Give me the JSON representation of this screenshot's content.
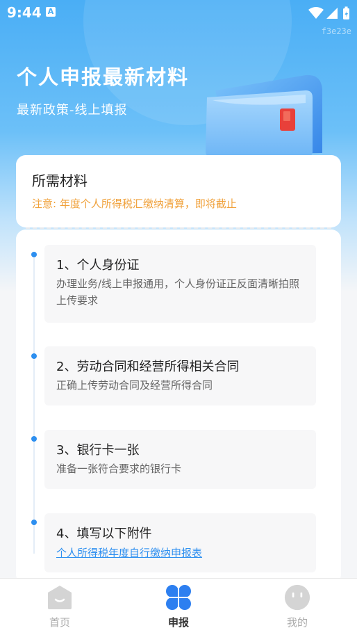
{
  "status_bar": {
    "time": "9:44",
    "notification_icon": "A",
    "icons": [
      "wifi-icon",
      "signal-icon",
      "battery-icon"
    ]
  },
  "watermark": "f3e23e",
  "hero": {
    "title": "个人申报最新材料",
    "subtitle": "最新政策-线上填报"
  },
  "materials_card": {
    "title": "所需材料",
    "note": "注意: 年度个人所得税汇缴纳清算，即将截止"
  },
  "materials": [
    {
      "title": "1、个人身份证",
      "desc": "办理业务/线上申报通用，个人身份证正反面清晰拍照上传要求"
    },
    {
      "title": "2、劳动合同和经营所得相关合同",
      "desc": "正确上传劳动合同及经营所得合同"
    },
    {
      "title": "3、银行卡一张",
      "desc": "准备一张符合要求的银行卡"
    },
    {
      "title": "4、填写以下附件",
      "link": "个人所得税年度自行缴纳申报表"
    }
  ],
  "tabbar": {
    "tabs": [
      {
        "label": "首页",
        "icon": "home-icon",
        "active": false
      },
      {
        "label": "申报",
        "icon": "declare-icon",
        "active": true
      },
      {
        "label": "我的",
        "icon": "profile-icon",
        "active": false
      }
    ]
  },
  "colors": {
    "accent": "#2d8ff0",
    "warning": "#f0a13b",
    "hero_top": "#4aaef5"
  }
}
